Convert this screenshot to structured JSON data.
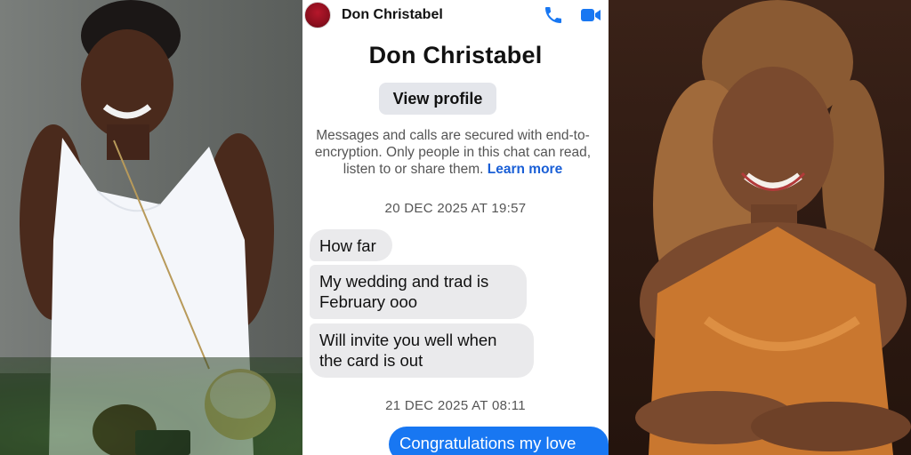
{
  "chat": {
    "header_name": "Don Christabel",
    "profile_name": "Don Christabel",
    "view_profile_label": "View profile",
    "encryption_line1": "Messages and calls are secured with end-to-",
    "encryption_line2": "encryption. Only people in this chat can read,",
    "encryption_line3_text": "listen to or share them. ",
    "learn_more_label": "Learn more",
    "timestamps": [
      "20 DEC 2025 AT 19:57",
      "21 DEC 2025 AT 08:11"
    ],
    "received_messages": [
      "How far",
      "My wedding and trad is February ooo",
      "Will invite you well when the card is out"
    ],
    "sent_messages": [
      "Congratulations my love"
    ],
    "icons": {
      "call": "phone-icon",
      "video": "video-camera-icon"
    },
    "colors": {
      "accent": "#1877f2",
      "bubble_received": "#eaeaec",
      "link": "#1a5fd6"
    }
  }
}
